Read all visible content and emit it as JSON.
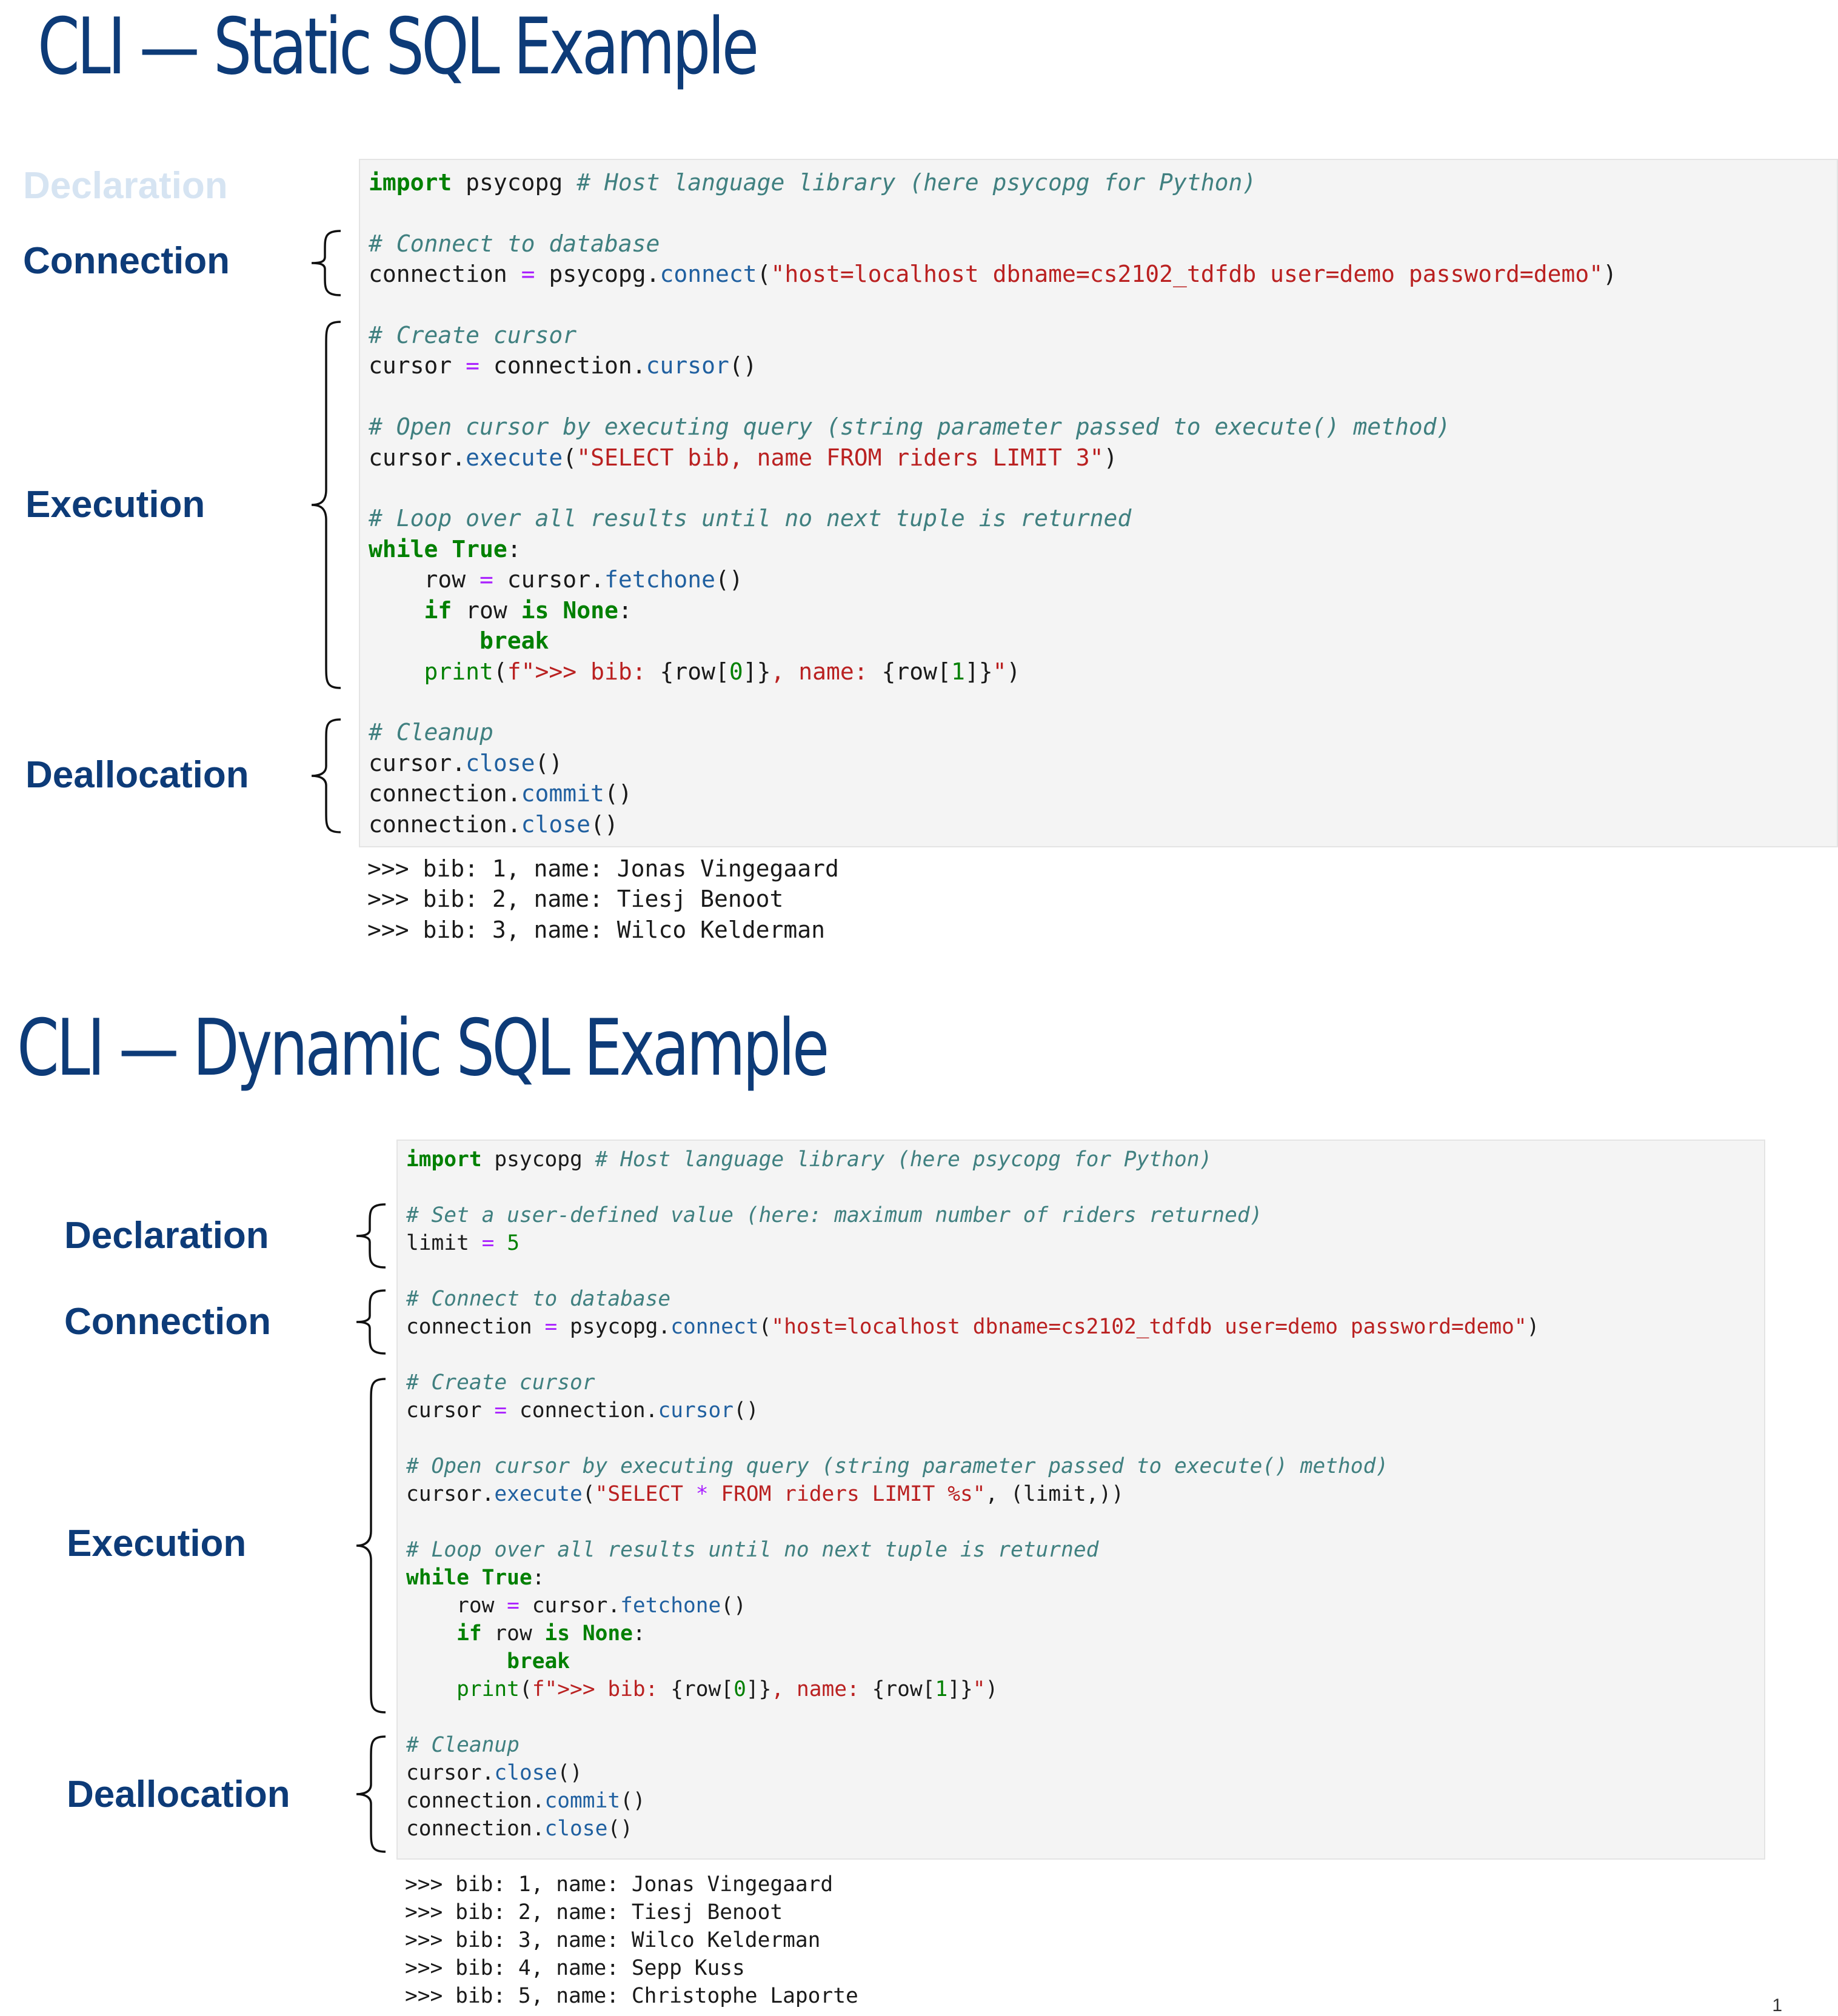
{
  "slides": [
    {
      "title": "CLI — Static SQL Example",
      "phases": {
        "declaration": "Declaration",
        "connection": "Connection",
        "execution": "Execution",
        "deallocation": "Deallocation"
      },
      "code_lines": [
        [
          [
            "kw",
            "import"
          ],
          [
            "t",
            " psycopg "
          ],
          [
            "cm",
            "# Host language library (here psycopg for Python)"
          ]
        ],
        [],
        [
          [
            "cm",
            "# Connect to database"
          ]
        ],
        [
          [
            "t",
            "connection "
          ],
          [
            "op",
            "="
          ],
          [
            "t",
            " psycopg."
          ],
          [
            "fn",
            "connect"
          ],
          [
            "t",
            "("
          ],
          [
            "st",
            "\"host=localhost dbname=cs2102_tdfdb user=demo password=demo\""
          ],
          [
            "t",
            ")"
          ]
        ],
        [],
        [
          [
            "cm",
            "# Create cursor"
          ]
        ],
        [
          [
            "t",
            "cursor "
          ],
          [
            "op",
            "="
          ],
          [
            "t",
            " connection."
          ],
          [
            "fn",
            "cursor"
          ],
          [
            "t",
            "()"
          ]
        ],
        [],
        [
          [
            "cm",
            "# Open cursor by executing query (string parameter passed to execute() method)"
          ]
        ],
        [
          [
            "t",
            "cursor."
          ],
          [
            "fn",
            "execute"
          ],
          [
            "t",
            "("
          ],
          [
            "st",
            "\"SELECT bib, name FROM riders LIMIT 3\""
          ],
          [
            "t",
            ")"
          ]
        ],
        [],
        [
          [
            "cm",
            "# Loop over all results until no next tuple is returned"
          ]
        ],
        [
          [
            "kw",
            "while"
          ],
          [
            "t",
            " "
          ],
          [
            "kw",
            "True"
          ],
          [
            "t",
            ":"
          ]
        ],
        [
          [
            "t",
            "    row "
          ],
          [
            "op",
            "="
          ],
          [
            "t",
            " cursor."
          ],
          [
            "fn",
            "fetchone"
          ],
          [
            "t",
            "()"
          ]
        ],
        [
          [
            "t",
            "    "
          ],
          [
            "kw",
            "if"
          ],
          [
            "t",
            " row "
          ],
          [
            "kw",
            "is"
          ],
          [
            "t",
            " "
          ],
          [
            "kw",
            "None"
          ],
          [
            "t",
            ":"
          ]
        ],
        [
          [
            "t",
            "        "
          ],
          [
            "kw",
            "break"
          ]
        ],
        [
          [
            "t",
            "    "
          ],
          [
            "bi",
            "print"
          ],
          [
            "t",
            "("
          ],
          [
            "st",
            "f\">>> bib: "
          ],
          [
            "t",
            "{row["
          ],
          [
            "nm",
            "0"
          ],
          [
            "t",
            "]}"
          ],
          [
            "st",
            ", name: "
          ],
          [
            "t",
            "{row["
          ],
          [
            "nm",
            "1"
          ],
          [
            "t",
            "]}"
          ],
          [
            "st",
            "\""
          ],
          [
            "t",
            ")"
          ]
        ],
        [],
        [
          [
            "cm",
            "# Cleanup"
          ]
        ],
        [
          [
            "t",
            "cursor."
          ],
          [
            "fn",
            "close"
          ],
          [
            "t",
            "()"
          ]
        ],
        [
          [
            "t",
            "connection."
          ],
          [
            "fn",
            "commit"
          ],
          [
            "t",
            "()"
          ]
        ],
        [
          [
            "t",
            "connection."
          ],
          [
            "fn",
            "close"
          ],
          [
            "t",
            "()"
          ]
        ]
      ],
      "output_lines": [
        ">>> bib: 1, name: Jonas Vingegaard",
        ">>> bib: 2, name: Tiesj Benoot",
        ">>> bib: 3, name: Wilco Kelderman"
      ]
    },
    {
      "title": "CLI — Dynamic SQL Example",
      "phases": {
        "declaration": "Declaration",
        "connection": "Connection",
        "execution": "Execution",
        "deallocation": "Deallocation"
      },
      "code_lines": [
        [
          [
            "kw",
            "import"
          ],
          [
            "t",
            " psycopg "
          ],
          [
            "cm",
            "# Host language library (here psycopg for Python)"
          ]
        ],
        [],
        [
          [
            "cm",
            "# Set a user-defined value (here: maximum number of riders returned)"
          ]
        ],
        [
          [
            "t",
            "limit "
          ],
          [
            "op",
            "="
          ],
          [
            "t",
            " "
          ],
          [
            "nm",
            "5"
          ]
        ],
        [],
        [
          [
            "cm",
            "# Connect to database"
          ]
        ],
        [
          [
            "t",
            "connection "
          ],
          [
            "op",
            "="
          ],
          [
            "t",
            " psycopg."
          ],
          [
            "fn",
            "connect"
          ],
          [
            "t",
            "("
          ],
          [
            "st",
            "\"host=localhost dbname=cs2102_tdfdb user=demo password=demo\""
          ],
          [
            "t",
            ")"
          ]
        ],
        [],
        [
          [
            "cm",
            "# Create cursor"
          ]
        ],
        [
          [
            "t",
            "cursor "
          ],
          [
            "op",
            "="
          ],
          [
            "t",
            " connection."
          ],
          [
            "fn",
            "cursor"
          ],
          [
            "t",
            "()"
          ]
        ],
        [],
        [
          [
            "cm",
            "# Open cursor by executing query (string parameter passed to execute() method)"
          ]
        ],
        [
          [
            "t",
            "cursor."
          ],
          [
            "fn",
            "execute"
          ],
          [
            "t",
            "("
          ],
          [
            "st",
            "\"SELECT "
          ],
          [
            "op",
            "*"
          ],
          [
            "st",
            " FROM riders LIMIT %s\""
          ],
          [
            "t",
            ", (limit,))"
          ]
        ],
        [],
        [
          [
            "cm",
            "# Loop over all results until no next tuple is returned"
          ]
        ],
        [
          [
            "kw",
            "while"
          ],
          [
            "t",
            " "
          ],
          [
            "kw",
            "True"
          ],
          [
            "t",
            ":"
          ]
        ],
        [
          [
            "t",
            "    row "
          ],
          [
            "op",
            "="
          ],
          [
            "t",
            " cursor."
          ],
          [
            "fn",
            "fetchone"
          ],
          [
            "t",
            "()"
          ]
        ],
        [
          [
            "t",
            "    "
          ],
          [
            "kw",
            "if"
          ],
          [
            "t",
            " row "
          ],
          [
            "kw",
            "is"
          ],
          [
            "t",
            " "
          ],
          [
            "kw",
            "None"
          ],
          [
            "t",
            ":"
          ]
        ],
        [
          [
            "t",
            "        "
          ],
          [
            "kw",
            "break"
          ]
        ],
        [
          [
            "t",
            "    "
          ],
          [
            "bi",
            "print"
          ],
          [
            "t",
            "("
          ],
          [
            "st",
            "f\">>> bib: "
          ],
          [
            "t",
            "{row["
          ],
          [
            "nm",
            "0"
          ],
          [
            "t",
            "]}"
          ],
          [
            "st",
            ", name: "
          ],
          [
            "t",
            "{row["
          ],
          [
            "nm",
            "1"
          ],
          [
            "t",
            "]}"
          ],
          [
            "st",
            "\""
          ],
          [
            "t",
            ")"
          ]
        ],
        [],
        [
          [
            "cm",
            "# Cleanup"
          ]
        ],
        [
          [
            "t",
            "cursor."
          ],
          [
            "fn",
            "close"
          ],
          [
            "t",
            "()"
          ]
        ],
        [
          [
            "t",
            "connection."
          ],
          [
            "fn",
            "commit"
          ],
          [
            "t",
            "()"
          ]
        ],
        [
          [
            "t",
            "connection."
          ],
          [
            "fn",
            "close"
          ],
          [
            "t",
            "()"
          ]
        ]
      ],
      "output_lines": [
        ">>> bib: 1, name: Jonas Vingegaard",
        ">>> bib: 2, name: Tiesj Benoot",
        ">>> bib: 3, name: Wilco Kelderman",
        ">>> bib: 4, name: Sepp Kuss",
        ">>> bib: 5, name: Christophe Laporte"
      ]
    }
  ],
  "page_number": "1",
  "colors": {
    "title": "#0d3b78",
    "phase_label": "#0d3b78",
    "phase_faded": "#d6e4f2",
    "code_bg": "#f4f4f4",
    "keyword": "#008000",
    "comment": "#408080",
    "string": "#ba2121",
    "operator": "#aa22ff",
    "function": "#2060a0"
  }
}
